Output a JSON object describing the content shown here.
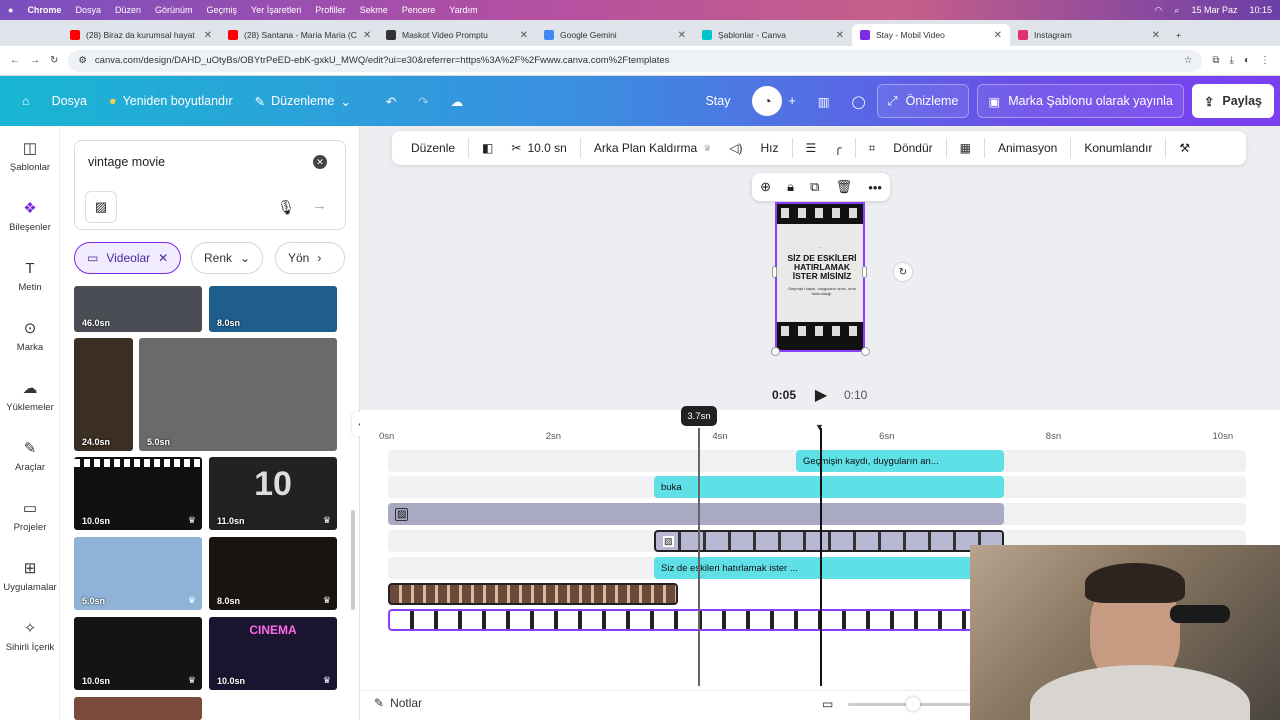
{
  "menubar": {
    "apple": "",
    "app": "Chrome",
    "items": [
      "Dosya",
      "Düzen",
      "Görünüm",
      "Geçmiş",
      "Yer İşaretleri",
      "Profiller",
      "Sekme",
      "Pencere",
      "Yardım"
    ],
    "date": "15 Mar Paz",
    "time": "10:15"
  },
  "tabs": [
    {
      "label": "(28) Biraz da kurumsal hayat",
      "color": "#ff0000"
    },
    {
      "label": "(28) Santana - Maria Maria (C",
      "color": "#ff0000"
    },
    {
      "label": "Maskot Video Promptu",
      "color": "#333333"
    },
    {
      "label": "Google Gemini",
      "color": "#4285f4"
    },
    {
      "label": "Şablonlar - Canva",
      "color": "#00c4cc"
    },
    {
      "label": "Stay - Mobil Video",
      "color": "#7d2ae8",
      "active": true
    },
    {
      "label": "Instagram",
      "color": "#e1306c"
    }
  ],
  "address": {
    "url": "canva.com/design/DAHD_uOtyBs/OBYtrPeED-ebK-gxkU_MWQ/edit?ui=e30&referrer=https%3A%2F%2Fwww.canva.com%2Ftemplates"
  },
  "header": {
    "file": "Dosya",
    "resize": "Yeniden boyutlandır",
    "edit": "Düzenleme",
    "title": "Stay",
    "present": "Önizleme",
    "publish": "Marka Şablonu olarak yayınla",
    "share": "Paylaş"
  },
  "rail": [
    {
      "label": "Şablonlar",
      "icon": "templates-icon"
    },
    {
      "label": "Bileşenler",
      "icon": "elements-icon",
      "active": true
    },
    {
      "label": "Metin",
      "icon": "text-icon"
    },
    {
      "label": "Marka",
      "icon": "brand-icon"
    },
    {
      "label": "Yüklemeler",
      "icon": "upload-icon"
    },
    {
      "label": "Araçlar",
      "icon": "tools-icon"
    },
    {
      "label": "Projeler",
      "icon": "folder-icon"
    },
    {
      "label": "Uygulamalar",
      "icon": "apps-icon"
    },
    {
      "label": "Sihirli İçerik",
      "icon": "magic-icon"
    }
  ],
  "search": {
    "value": "vintage movie"
  },
  "filters": {
    "videos": "Videolar",
    "color": "Renk",
    "orientation": "Yön"
  },
  "thumbs": [
    {
      "dur": "46.0sn",
      "bg": "#4a4e54"
    },
    {
      "dur": "8.0sn",
      "bg": "#1f5e8c"
    },
    {
      "dur": "24.0sn",
      "bg": "#3b2e22"
    },
    {
      "dur": "5.0sn",
      "bg": "#6a6a6a"
    },
    {
      "dur": "10.0sn",
      "bg": "#111111"
    },
    {
      "dur": "11.0sn",
      "bg": "#222222"
    },
    {
      "dur": "5.0sn",
      "bg": "#8fb3d6"
    },
    {
      "dur": "8.0sn",
      "bg": "#1a1410"
    },
    {
      "dur": "10.0sn",
      "bg": "#141414"
    },
    {
      "dur": "10.0sn",
      "bg": "#1b1430"
    }
  ],
  "thumb_text": {
    "countdown": "10",
    "cinema": "CINEMA"
  },
  "context": {
    "edit": "Düzenle",
    "duration": "10.0 sn",
    "bgremove": "Arka Plan Kaldırma",
    "speed": "Hız",
    "rotate": "Döndür",
    "animation": "Animasyon",
    "position": "Konumlandır"
  },
  "canvas": {
    "small": "....",
    "title": "SİZ DE ESKİLERİ HATIRLAMAK İSTER MİSİNİZ",
    "sub": "Geçmişin kaydı, duyguların anısı, anın farkındalığı."
  },
  "player": {
    "current": "0:05",
    "total": "0:10"
  },
  "timeline": {
    "playhead_label": "3.7sn",
    "ticks": [
      "0sn",
      "2sn",
      "4sn",
      "6sn",
      "8sn",
      "10sn"
    ],
    "clips": [
      {
        "label": "Geçmişin kaydı, duyguların an..."
      },
      {
        "label": "buka"
      },
      {
        "label": "Siz de eskileri hatırlamak ister ..."
      }
    ],
    "notes": "Notlar"
  }
}
